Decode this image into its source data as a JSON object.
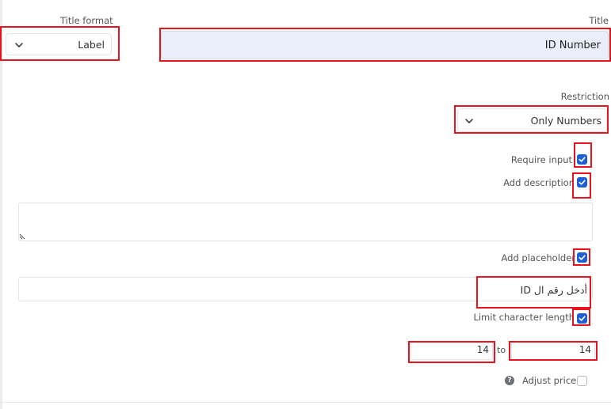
{
  "title_format": {
    "label": "Title format",
    "value": "Label"
  },
  "title": {
    "label": "Title",
    "value": "ID Number"
  },
  "restriction": {
    "label": "Restriction",
    "value": "Only Numbers"
  },
  "require_input": {
    "label": "Require input",
    "checked": true
  },
  "add_description": {
    "label": "Add description",
    "checked": true,
    "value": ""
  },
  "add_placeholder": {
    "label": "Add placeholder",
    "checked": true,
    "value": "أدخل رقم ال ID"
  },
  "limit_character_length": {
    "label": "Limit character length",
    "checked": true,
    "min": "14",
    "separator": "to",
    "max": "14"
  },
  "adjust_price": {
    "label": "Adjust price",
    "checked": false
  },
  "colors": {
    "highlight": "#e8131c",
    "checkbox": "#1f5fd6",
    "title_field_bg": "#e8eefa"
  },
  "icons": {
    "dropdown": "chevron-down-icon",
    "checkbox": "check-icon",
    "help": "question-mark-icon",
    "resize": "resize-handle-icon"
  }
}
